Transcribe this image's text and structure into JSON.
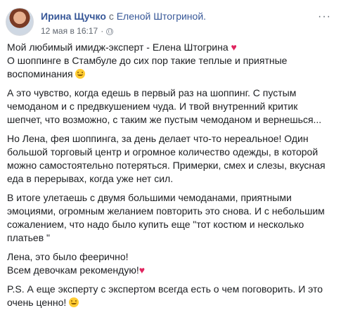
{
  "post": {
    "author": "Ирина Щучко",
    "with_word": "с",
    "tagged": "Еленой Штогриной.",
    "date": "12 мая в 16:17",
    "dot": "·",
    "privacy_icon": "globe-icon",
    "more_icon": "ellipsis-icon",
    "more_text": "···"
  },
  "text": {
    "p1_a": "Мой любимый имидж-эксперт - ",
    "p1_name": "Елена Штогрина",
    "p1_b": "О шоппинге в Стамбуле до сих пор такие теплые и приятные воспоминания",
    "p2": "А это чувство, когда едешь в первый раз на шоппинг. С пустым чемоданом и с предвкушением чуда. И твой внутренний критик шепчет, что возможно, с таким же пустым чемоданом и вернешься...",
    "p3": "Но Лена, фея шоппинга, за день делает что-то нереальное! Один большой торговый центр и огромное количество одежды, в которой можно самостоятельно потеряться. Примерки, смех и слезы, вкусная еда в перерывах, когда уже нет сил.",
    "p4": "В итоге улетаешь с двумя большими чемоданами, приятными эмоциями, огромным желанием повторить это снова. И с небольшим сожалением, что надо было купить еще \"тот костюм и несколько платьев \"",
    "p5_a": "Лена, это было феерично!",
    "p5_b": "Всем девочкам рекомендую!",
    "p6": "P.S. А еще эксперту с экспертом всегда есть о чем поговорить. И это очень ценно!",
    "heart": "♥"
  },
  "icons": {
    "heart": "heart-icon",
    "smile": "smiley-icon"
  },
  "colors": {
    "link": "#385898",
    "meta": "#606770",
    "text": "#1c1e21",
    "heart": "#e0245e"
  }
}
